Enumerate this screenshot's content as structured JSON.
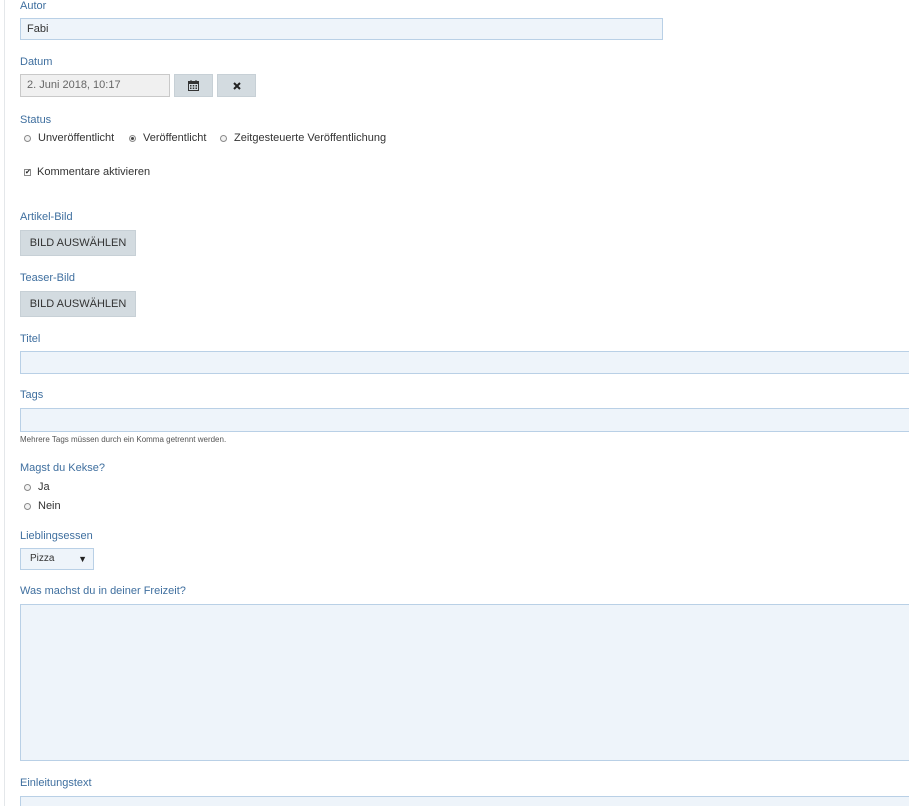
{
  "form": {
    "autor": {
      "label": "Autor",
      "value": "Fabi"
    },
    "datum": {
      "label": "Datum",
      "value": "2. Juni 2018, 10:17",
      "calendar_icon": "calendar-icon",
      "clear_icon": "close-icon"
    },
    "status": {
      "label": "Status",
      "options": [
        "Unveröffentlicht",
        "Veröffentlicht",
        "Zeitgesteuerte Veröffentlichung"
      ],
      "selected": "Veröffentlicht"
    },
    "kommentare": {
      "label": "Kommentare aktivieren",
      "checked": true
    },
    "artikel_bild": {
      "label": "Artikel-Bild",
      "button": "BILD AUSWÄHLEN"
    },
    "teaser_bild": {
      "label": "Teaser-Bild",
      "button": "BILD AUSWÄHLEN"
    },
    "titel": {
      "label": "Titel",
      "value": ""
    },
    "tags": {
      "label": "Tags",
      "value": "",
      "help": "Mehrere Tags müssen durch ein Komma getrennt werden."
    },
    "kekse": {
      "label": "Magst du Kekse?",
      "options": [
        "Ja",
        "Nein"
      ],
      "selected": ""
    },
    "lieblingsessen": {
      "label": "Lieblingsessen",
      "value": "Pizza"
    },
    "freizeit": {
      "label": "Was machst du in deiner Freizeit?",
      "value": ""
    },
    "einleitung": {
      "label": "Einleitungstext",
      "value": ""
    }
  }
}
